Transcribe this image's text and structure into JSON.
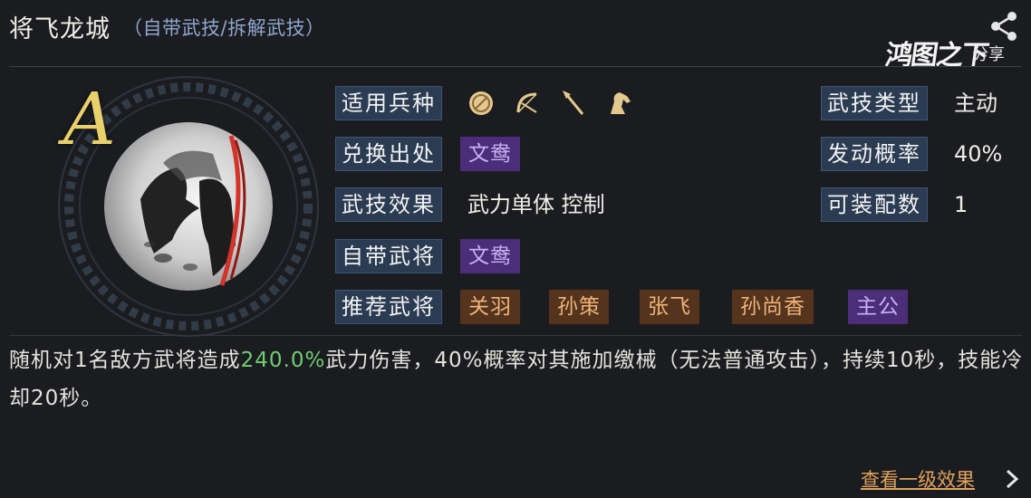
{
  "header": {
    "title": "将飞龙城",
    "subtitle": "（自带武技/拆解武技）",
    "logo_text": "鸿图之下",
    "share_label": "分享"
  },
  "skill": {
    "grade": "A",
    "fields": {
      "troop_types_label": "适用兵种",
      "troop_type_icons": [
        "shield-icon",
        "bow-icon",
        "spear-icon",
        "horse-icon"
      ],
      "source_label": "兑换出处",
      "source_value": "文鸯",
      "effect_label": "武技效果",
      "effect_value": "武力单体 控制",
      "own_general_label": "自带武将",
      "own_general_value": "文鸯",
      "recommend_label": "推荐武将",
      "recommend_values": [
        "关羽",
        "孙策",
        "张飞",
        "孙尚香",
        "主公"
      ],
      "skill_type_label": "武技类型",
      "skill_type_value": "主动",
      "trigger_rate_label": "发动概率",
      "trigger_rate_value": "40%",
      "equip_count_label": "可装配数",
      "equip_count_value": "1"
    }
  },
  "description": {
    "part1": "随机对1名敌方武将造成",
    "highlight": "240.0%",
    "part2": "武力伤害，40%概率对其施加缴械（无法普通攻击），持续10秒，技能冷却20秒。"
  },
  "footer": {
    "more_link": "查看一级效果"
  },
  "colors": {
    "background": "#1b1c20",
    "label_bg": "#2a3b52",
    "purple_chip": "#4b2d7a",
    "brown_chip": "#54341d",
    "highlight_green": "#6fce70",
    "grade_gold": "#e8d06a"
  }
}
